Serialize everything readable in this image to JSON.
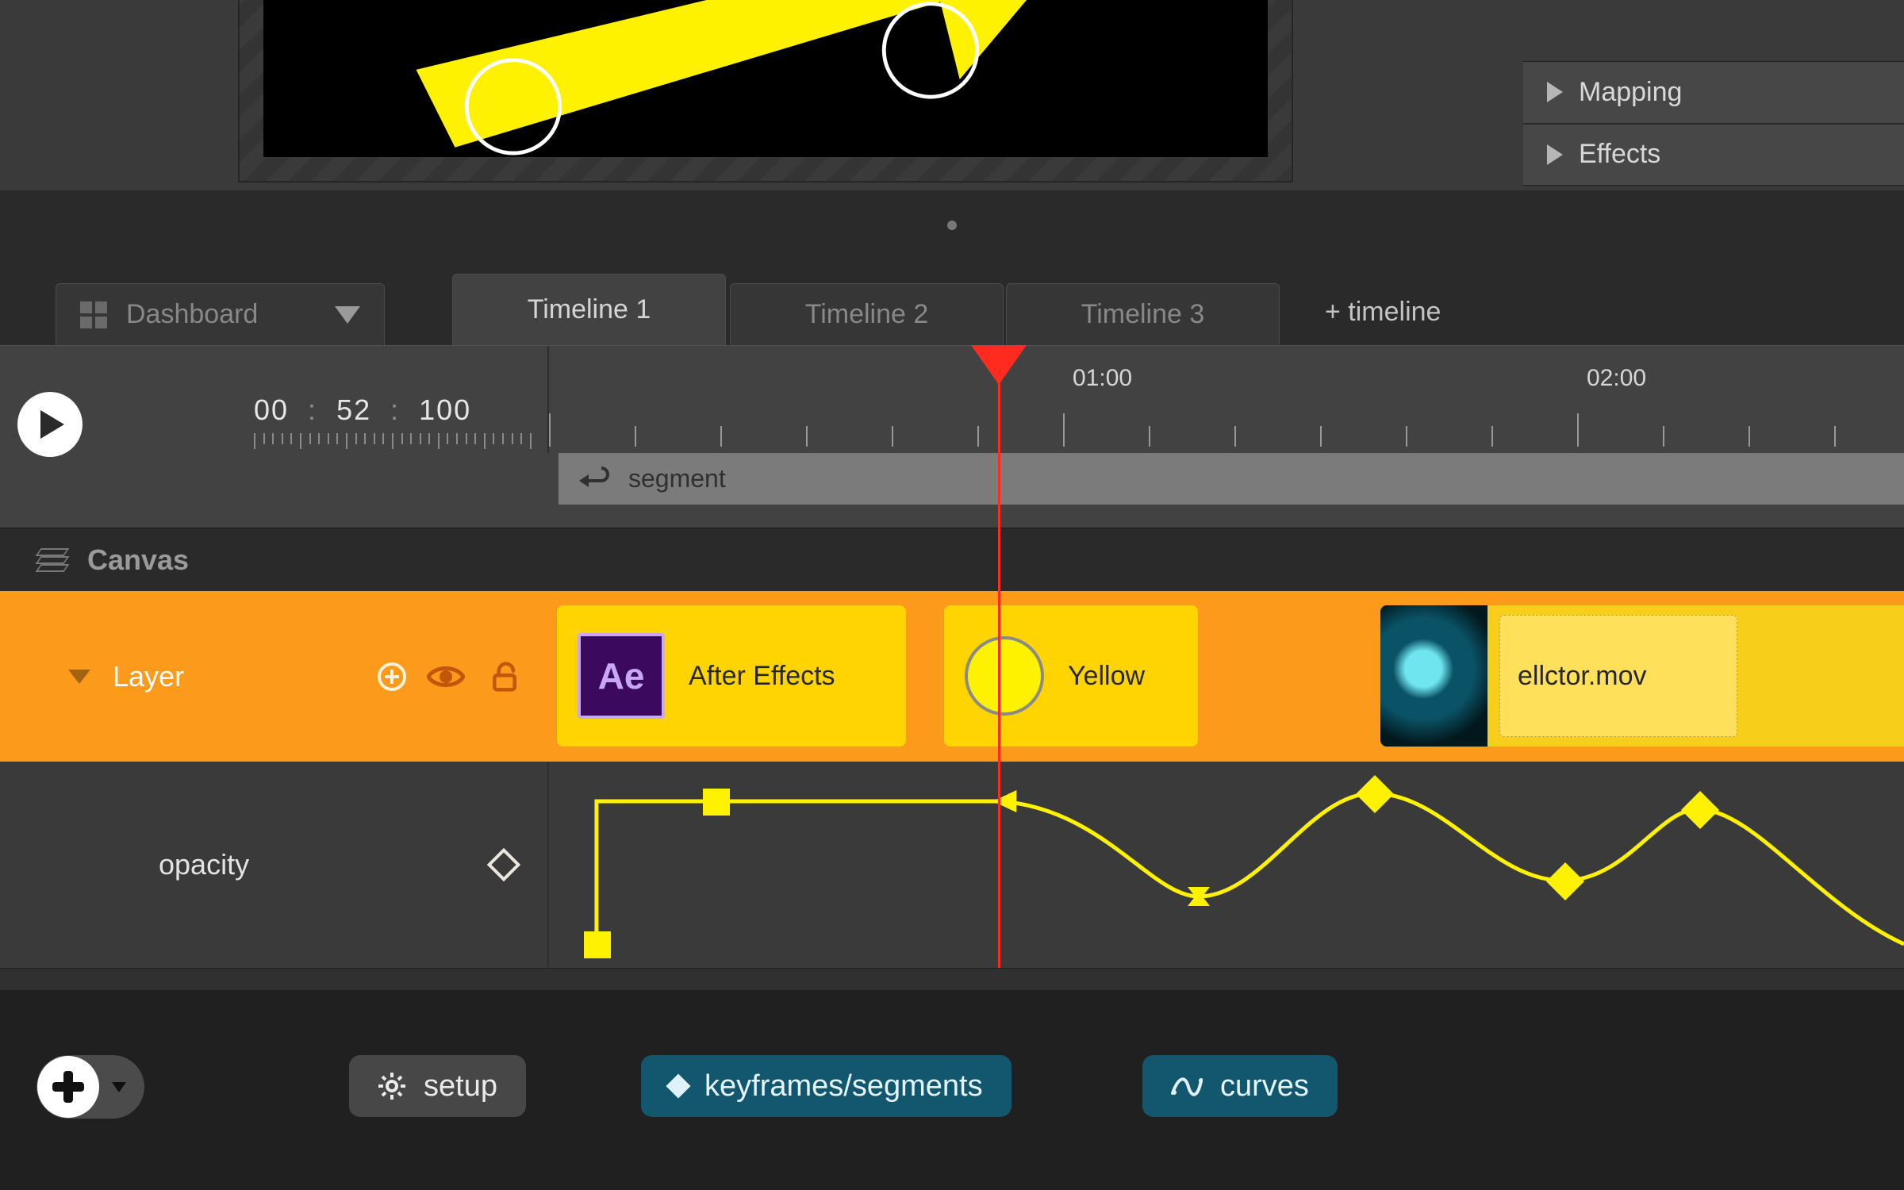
{
  "side_panels": {
    "mapping": "Mapping",
    "effects": "Effects"
  },
  "tabs": {
    "dashboard": "Dashboard",
    "timeline1": "Timeline 1",
    "timeline2": "Timeline 2",
    "timeline3": "Timeline 3",
    "add": "+ timeline"
  },
  "transport": {
    "tc_h": "00",
    "tc_m": "52",
    "tc_f": "100",
    "ruler_labels": {
      "l1": "01:00",
      "l2": "02:00"
    },
    "segment_label": "segment"
  },
  "canvas": {
    "title": "Canvas"
  },
  "layer": {
    "name": "Layer",
    "clips": {
      "c1": "After Effects",
      "ae_badge": "Ae",
      "c2": "Yellow",
      "c3": "ellctor.mov"
    }
  },
  "property": {
    "name": "opacity"
  },
  "bottom": {
    "setup": "setup",
    "keyframes": "keyframes/segments",
    "curves": "curves"
  }
}
